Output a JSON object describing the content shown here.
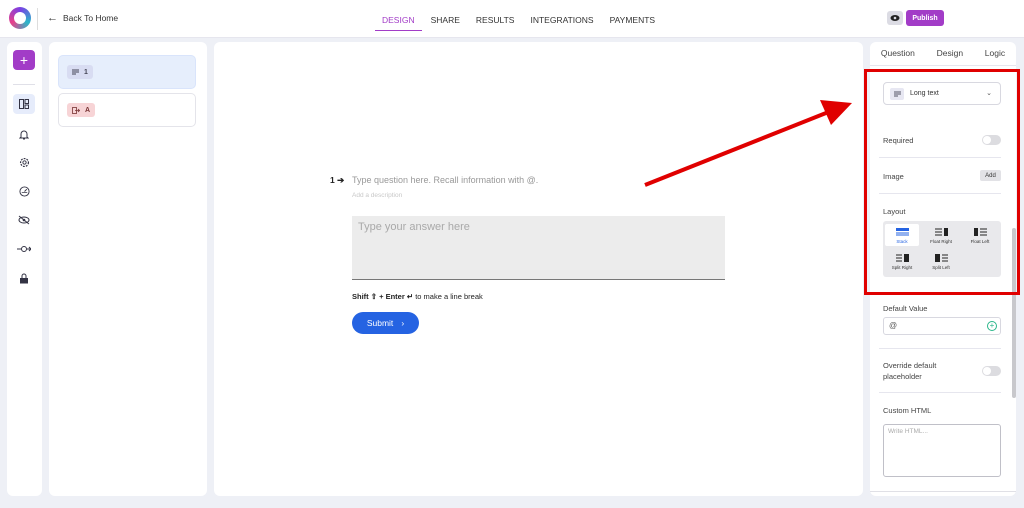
{
  "header": {
    "back_label": "Back To Home",
    "tabs": [
      {
        "label": "DESIGN",
        "active": true
      },
      {
        "label": "SHARE"
      },
      {
        "label": "RESULTS"
      },
      {
        "label": "INTEGRATIONS"
      },
      {
        "label": "PAYMENTS"
      }
    ],
    "publish_label": "Publish"
  },
  "sidebar": {
    "icons": [
      "plus-icon",
      "layout-icon",
      "bell-icon",
      "gear-icon",
      "speedometer-icon",
      "eye-off-icon",
      "connector-icon",
      "lock-icon"
    ]
  },
  "question_list": [
    {
      "label": "1",
      "type": "long-text"
    },
    {
      "label": "A",
      "type": "exit"
    }
  ],
  "canvas": {
    "number": "1",
    "question_placeholder": "Type question here. Recall information with @.",
    "description_placeholder": "Add a description",
    "answer_placeholder": "Type your answer here",
    "hint_bold": "Shift ⇧ + Enter ↵",
    "hint_rest": " to make a line break",
    "submit_label": "Submit"
  },
  "right_panel": {
    "tabs": [
      "Question",
      "Design",
      "Logic"
    ],
    "active_tab": "Question",
    "type_label": "Long text",
    "required_label": "Required",
    "image_label": "Image",
    "add_label": "Add",
    "layout_label": "Layout",
    "layout_options": [
      "Stack",
      "Float Right",
      "Float Left",
      "Split Right",
      "Split Left"
    ],
    "selected_layout": "Stack",
    "default_value_label": "Default Value",
    "default_value": "@",
    "override_label_1": "Override default",
    "override_label_2": "placeholder",
    "custom_html_label": "Custom HTML",
    "custom_html_placeholder": "Write HTML..."
  },
  "colors": {
    "accent": "#a23cc7",
    "primary": "#2563e2",
    "annotation": "#e00000"
  }
}
